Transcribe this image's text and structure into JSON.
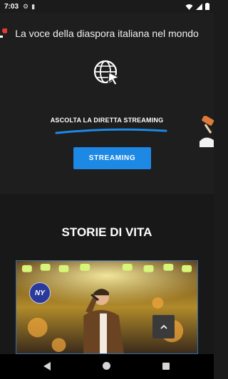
{
  "status_bar": {
    "time": "7:03",
    "icons": [
      "settings-icon",
      "sd-card-icon",
      "wifi-icon",
      "signal-icon",
      "battery-icon"
    ]
  },
  "hero": {
    "tagline": "La voce della diaspora italiana nel mondo",
    "listen_label": "ASCOLTA LA DIRETTA STREAMING",
    "streaming_button": "STREAMING",
    "accent_color": "#1e88e5"
  },
  "section": {
    "title": "STORIE DI VITA",
    "card_badge": "NY"
  }
}
